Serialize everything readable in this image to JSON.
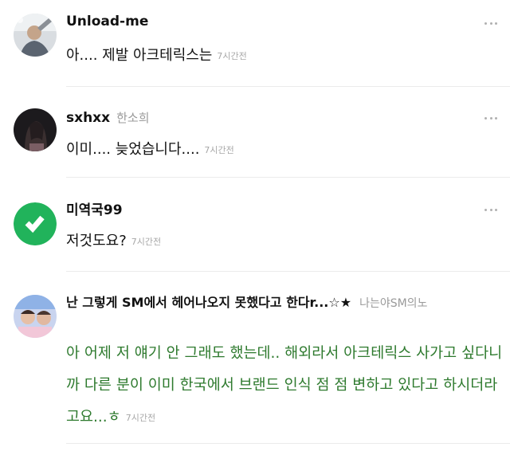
{
  "comments": [
    {
      "nickname": "Unload-me",
      "sub_nickname": "",
      "text": "아.... 제발 아크테릭스는",
      "time": "7시간전"
    },
    {
      "nickname": "sxhxx",
      "sub_nickname": "한소희",
      "text": "이미.... 늦었습니다....",
      "time": "7시간전"
    },
    {
      "nickname": "미역국99",
      "sub_nickname": "",
      "text": "저것도요?",
      "time": "7시간전"
    },
    {
      "nickname": "난 그렇게 SM에서 헤어나오지 못했다고 한다r...☆★",
      "sub_nickname": "나는야SM의노",
      "text": "아 어제 저 얘기 안 그래도 했는데.. 해외라서 아크테릭스 사가고 싶다니까 다른 분이 이미 한국에서 브랜드 인식 점 점 변하고 있다고 하시더라고요...ㅎ",
      "time": "7시간전"
    }
  ],
  "colors": {
    "accent_green": "#2e7a2e",
    "avatar_green": "#21b35b",
    "meta_gray": "#a7a7a7"
  },
  "icons": {
    "more": "more-vertical-dots-icon",
    "check_avatar": "check-logo-icon"
  }
}
